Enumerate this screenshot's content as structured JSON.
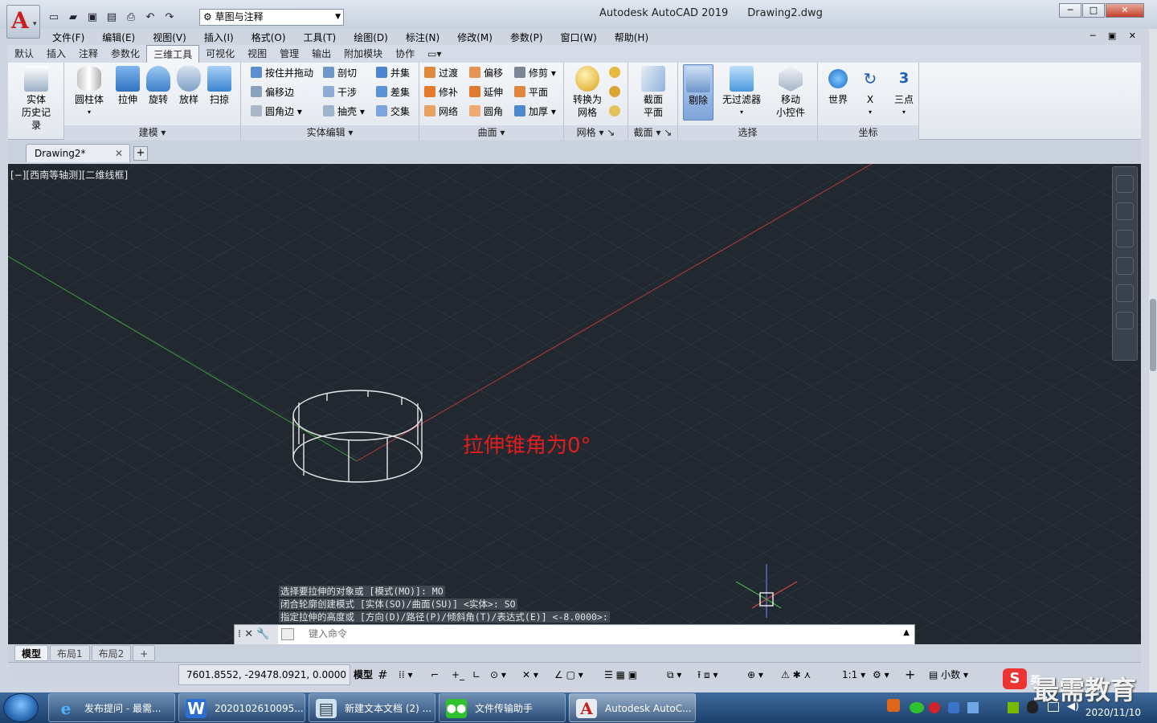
{
  "title": {
    "app": "Autodesk AutoCAD 2019",
    "file": "Drawing2.dwg"
  },
  "workspace": "草图与注释",
  "menu": [
    "文件(F)",
    "编辑(E)",
    "视图(V)",
    "插入(I)",
    "格式(O)",
    "工具(T)",
    "绘图(D)",
    "标注(N)",
    "修改(M)",
    "参数(P)",
    "窗口(W)",
    "帮助(H)"
  ],
  "tabs": [
    "默认",
    "插入",
    "注释",
    "参数化",
    "三维工具",
    "可视化",
    "视图",
    "管理",
    "输出",
    "附加模块",
    "协作"
  ],
  "active_tab": "三维工具",
  "ribbon": {
    "history": {
      "l1": "实体",
      "l2": "历史记录"
    },
    "modeling": {
      "cylinder": "圆柱体",
      "extrude": "拉伸",
      "revolve": "旋转",
      "loft": "放样",
      "sweep": "扫掠",
      "title": "建模"
    },
    "solid_edit": {
      "presspull": "按住并拖动",
      "offset_edge": "偏移边",
      "fillet_edge": "圆角边",
      "slice": "剖切",
      "interfere": "干涉",
      "shell": "抽壳",
      "union": "并集",
      "subtract": "差集",
      "intersect": "交集",
      "title": "实体编辑"
    },
    "surface": {
      "blend": "过渡",
      "patch": "修补",
      "network": "网络",
      "offset": "偏移",
      "extend": "延伸",
      "fillet": "圆角",
      "trim": "修剪",
      "planar": "平面",
      "thicken": "加厚",
      "title": "曲面"
    },
    "mesh": {
      "l1": "转换为",
      "l2": "网格",
      "title": "网格"
    },
    "section": {
      "l1": "截面",
      "l2": "平面",
      "title": "截面"
    },
    "selection": {
      "cull": "剔除",
      "nofilter": "无过滤器",
      "gizmo1": "移动",
      "gizmo2": "小控件",
      "title": "选择"
    },
    "ucs": {
      "world": "世界",
      "x": "X",
      "three": "三点",
      "title": "坐标"
    }
  },
  "doc_tab": "Drawing2*",
  "viewport_label": "[−][西南等轴测][二维线框]",
  "annotation": "拉伸锥角为0°",
  "command_history": [
    "选择要拉伸的对象或 [模式(MO)]: MO",
    "闭合轮廓创建模式 [实体(SO)/曲面(SU)] <实体>: SO",
    "指定拉伸的高度或 [方向(D)/路径(P)/倾斜角(T)/表达式(E)] <-8.0000>:"
  ],
  "command_placeholder": "键入命令",
  "layout_tabs": [
    "模型",
    "布局1",
    "布局2"
  ],
  "status": {
    "coords": "7601.8552, -29478.0921, 0.0000",
    "model": "模型",
    "scale": "1:1",
    "units": "小数"
  },
  "taskbar": {
    "items": [
      "发布提问 - 最需...",
      "2020102610095...",
      "新建文本文档 (2) ...",
      "文件传输助手",
      "Autodesk AutoC..."
    ],
    "date": "2020/11/10",
    "ime": "英"
  },
  "watermark": "最需教育",
  "colors": {
    "viewport": "#212830",
    "annotation": "#e11d1d",
    "x_axis": "#b33a3a",
    "y_axis": "#3a9a3a"
  }
}
